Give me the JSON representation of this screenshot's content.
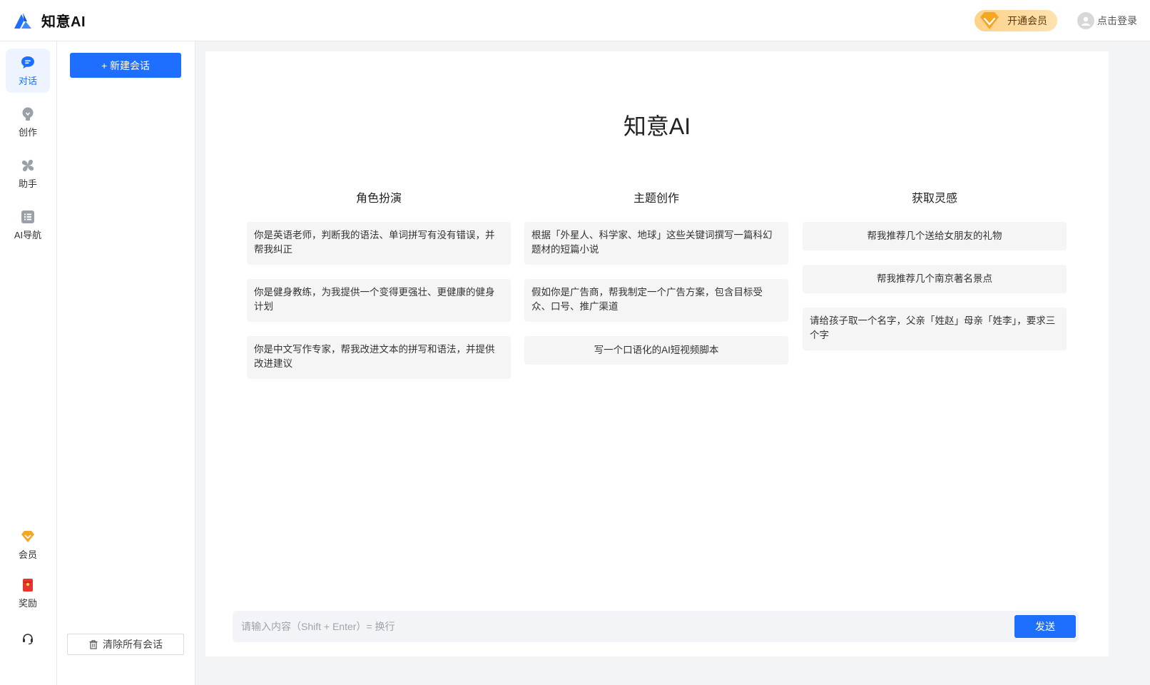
{
  "brand": {
    "name": "知意AI"
  },
  "header": {
    "vip_label": "开通会员",
    "login_label": "点击登录"
  },
  "rail": {
    "items": [
      {
        "label": "对话",
        "icon": "chat-bubble-icon"
      },
      {
        "label": "创作",
        "icon": "lightbulb-icon"
      },
      {
        "label": "助手",
        "icon": "pinwheel-icon"
      },
      {
        "label": "AI导航",
        "icon": "list-icon"
      }
    ],
    "bottom_items": [
      {
        "label": "会员",
        "icon": "diamond-icon"
      },
      {
        "label": "奖励",
        "icon": "red-envelope-icon"
      },
      {
        "label": "",
        "icon": "headset-icon"
      }
    ]
  },
  "sidebar": {
    "new_chat_label": "+ 新建会话",
    "clear_label": "清除所有会话"
  },
  "main": {
    "title": "知意AI",
    "columns": [
      {
        "title": "角色扮演",
        "cards": [
          "你是英语老师，判断我的语法、单词拼写有没有错误，并帮我纠正",
          "你是健身教练，为我提供一个变得更强壮、更健康的健身计划",
          "你是中文写作专家，帮我改进文本的拼写和语法，并提供改进建议"
        ]
      },
      {
        "title": "主题创作",
        "cards": [
          "根据「外星人、科学家、地球」这些关键词撰写一篇科幻题材的短篇小说",
          "假如你是广告商，帮我制定一个广告方案，包含目标受众、口号、推广渠道",
          "写一个口语化的AI短视频脚本"
        ]
      },
      {
        "title": "获取灵感",
        "cards": [
          "帮我推荐几个送给女朋友的礼物",
          "帮我推荐几个南京著名景点",
          "请给孩子取一个名字，父亲「姓赵」母亲「姓李」，要求三个字"
        ]
      }
    ]
  },
  "input": {
    "placeholder": "请输入内容（Shift + Enter）= 换行",
    "send_label": "发送"
  },
  "colors": {
    "accent": "#1e6fff",
    "vip_gold": "#ffd28a"
  }
}
